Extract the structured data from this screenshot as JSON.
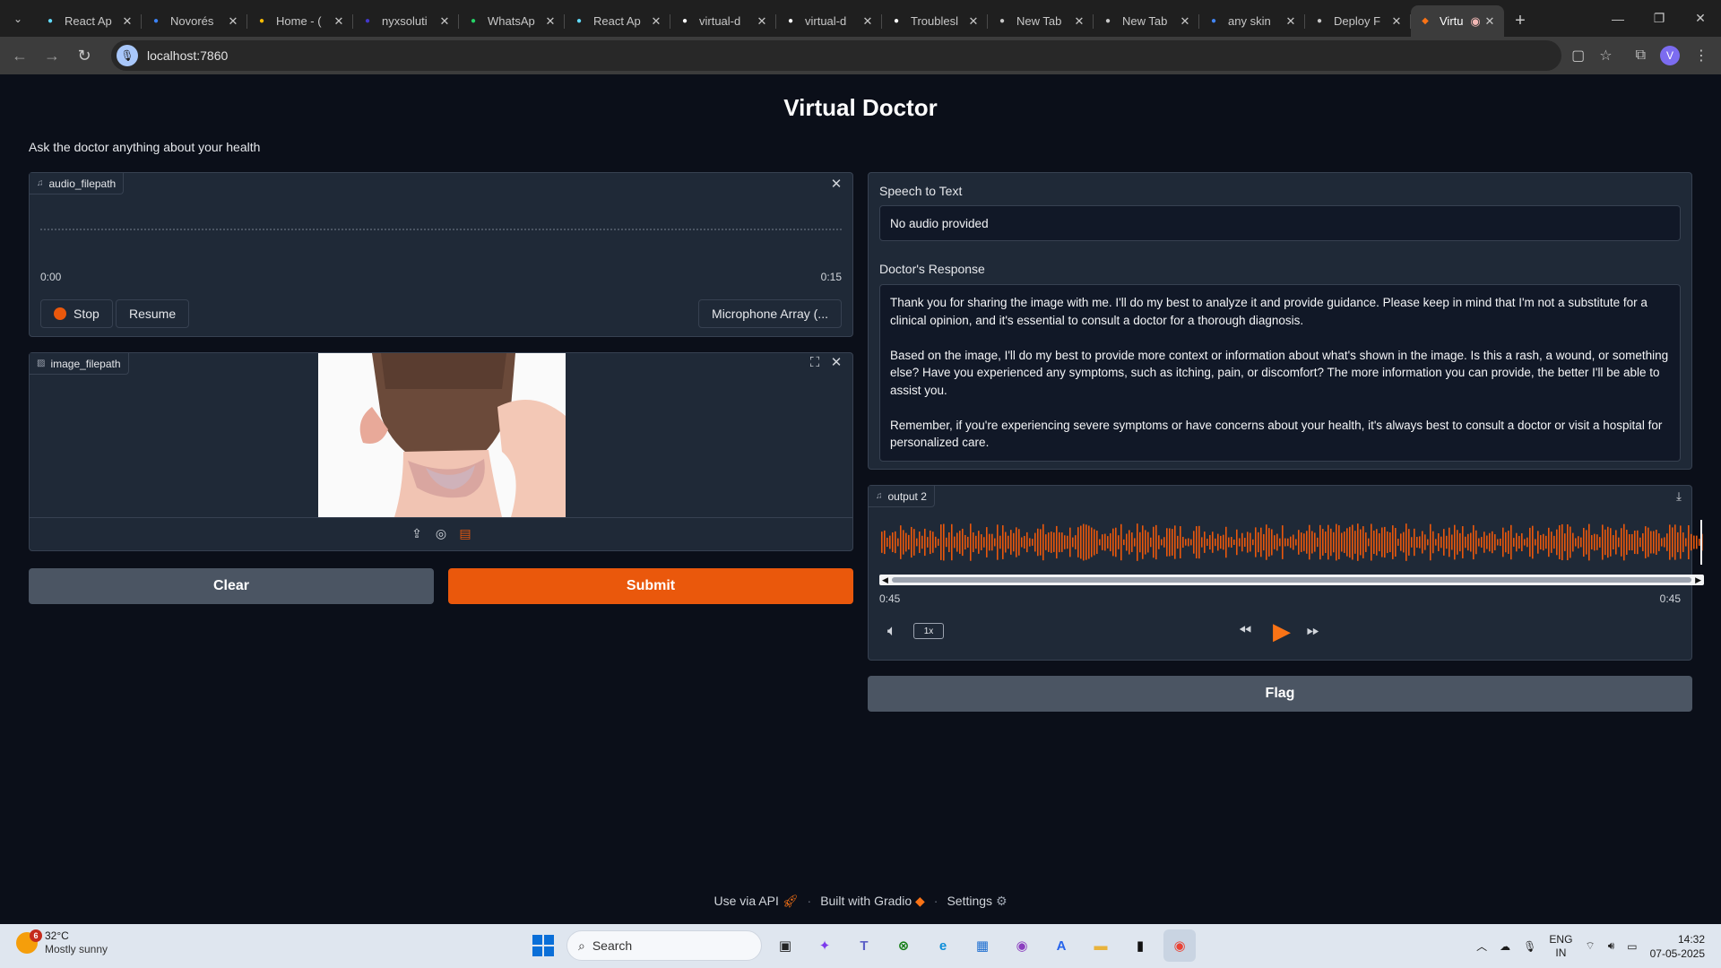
{
  "browser": {
    "tabs": [
      {
        "label": "React Ap",
        "icon": "react-icon",
        "color": "#61dafb"
      },
      {
        "label": "Novorés",
        "icon": "notion-like-icon",
        "color": "#3b82f6"
      },
      {
        "label": "Home - (",
        "icon": "drive-icon",
        "color": "#fbbc04"
      },
      {
        "label": "nyxsoluti",
        "icon": "nyx-icon",
        "color": "#4338ca"
      },
      {
        "label": "WhatsAp",
        "icon": "whatsapp-icon",
        "color": "#25d366"
      },
      {
        "label": "React Ap",
        "icon": "react-icon",
        "color": "#61dafb"
      },
      {
        "label": "virtual-d",
        "icon": "github-icon",
        "color": "#ffffff"
      },
      {
        "label": "virtual-d",
        "icon": "github-icon",
        "color": "#ffffff"
      },
      {
        "label": "Troublesl",
        "icon": "github-icon",
        "color": "#ffffff"
      },
      {
        "label": "New Tab",
        "icon": "chrome-icon",
        "color": "#c7c7c7"
      },
      {
        "label": "New Tab",
        "icon": "chrome-icon",
        "color": "#c7c7c7"
      },
      {
        "label": "any skin",
        "icon": "google-icon",
        "color": "#4285f4"
      },
      {
        "label": "Deploy F",
        "icon": "openai-icon",
        "color": "#c7c7c7"
      }
    ],
    "active_tab": {
      "label": "Virtu",
      "icon": "gradio-icon"
    },
    "url": "localhost:7860",
    "profile_initial": "V"
  },
  "app": {
    "title": "Virtual Doctor",
    "subtitle": "Ask the doctor anything about your health",
    "audio_input": {
      "label": "audio_filepath",
      "time_start": "0:00",
      "time_end": "0:15",
      "stop_label": "Stop",
      "resume_label": "Resume",
      "device_label": "Microphone Array (..."
    },
    "image_input": {
      "label": "image_filepath"
    },
    "clear_label": "Clear",
    "submit_label": "Submit",
    "speech_to_text": {
      "label": "Speech to Text",
      "value": "No audio provided"
    },
    "doctor_response": {
      "label": "Doctor's Response",
      "paragraphs": [
        "Thank you for sharing the image with me. I'll do my best to analyze it and provide guidance. Please keep in mind that I'm not a substitute for a clinical opinion, and it's essential to consult a doctor for a thorough diagnosis.",
        "Based on the image, I'll do my best to provide more context or information about what's shown in the image. Is this a rash, a wound, or something else? Have you experienced any symptoms, such as itching, pain, or discomfort? The more information you can provide, the better I'll be able to assist you.",
        "Remember, if you're experiencing severe symptoms or have concerns about your health, it's always best to consult a doctor or visit a hospital for personalized care."
      ]
    },
    "audio_output": {
      "label": "output 2",
      "time_current": "0:45",
      "time_total": "0:45",
      "speed": "1x"
    },
    "flag_label": "Flag",
    "footer": {
      "api": "Use via API",
      "built": "Built with Gradio",
      "settings": "Settings"
    },
    "colors": {
      "accent": "#ea580c",
      "background": "#0b0f19",
      "panel": "#1f2937"
    }
  },
  "taskbar": {
    "weather_temp": "32°C",
    "weather_desc": "Mostly sunny",
    "weather_badge": "6",
    "search_placeholder": "Search",
    "lang_line1": "ENG",
    "lang_line2": "IN",
    "time": "14:32",
    "date": "07-05-2025"
  }
}
